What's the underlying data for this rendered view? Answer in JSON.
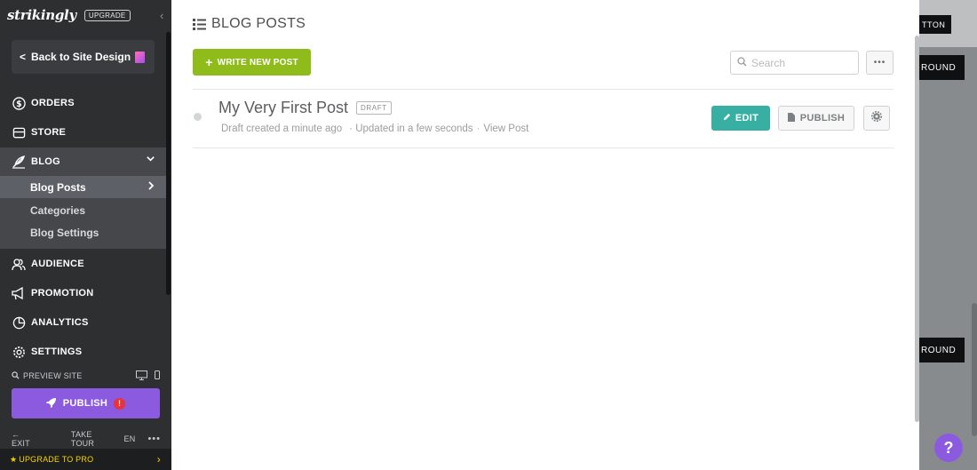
{
  "sidebar": {
    "logo": "strikingly",
    "upgrade_badge": "UPGRADE",
    "back_button": "Back to Site Design",
    "nav": {
      "orders": "ORDERS",
      "store": "STORE",
      "blog": "BLOG",
      "audience": "AUDIENCE",
      "promotion": "PROMOTION",
      "analytics": "ANALYTICS",
      "settings": "SETTINGS"
    },
    "blog_sub": {
      "posts": "Blog Posts",
      "categories": "Categories",
      "settings": "Blog Settings"
    },
    "preview_site": "PREVIEW SITE",
    "publish": "PUBLISH",
    "publish_alert": "!",
    "footer": {
      "exit": "EXIT",
      "tour": "TAKE TOUR",
      "lang": "EN",
      "more": "•••"
    },
    "upgrade_pro": "UPGRADE TO PRO"
  },
  "main": {
    "title": "BLOG POSTS",
    "write_button": "WRITE NEW POST",
    "search_placeholder": "Search",
    "more": "•••",
    "post": {
      "title": "My Very First Post",
      "badge": "DRAFT",
      "created": "Draft created a minute ago",
      "updated": "· Updated in a few seconds",
      "sep": "·",
      "view": "View Post",
      "edit": "EDIT",
      "publish": "PUBLISH"
    }
  },
  "preview": {
    "btn1": "TTON",
    "btn2": "ROUND",
    "btn3": "ROUND"
  },
  "help": "?",
  "colors": {
    "sidebar_bg": "#2e2f31",
    "accent_purple": "#8c5ade",
    "write_green": "#8fbc1a",
    "edit_teal": "#37b0a3",
    "upgrade_yellow": "#f5d500"
  }
}
